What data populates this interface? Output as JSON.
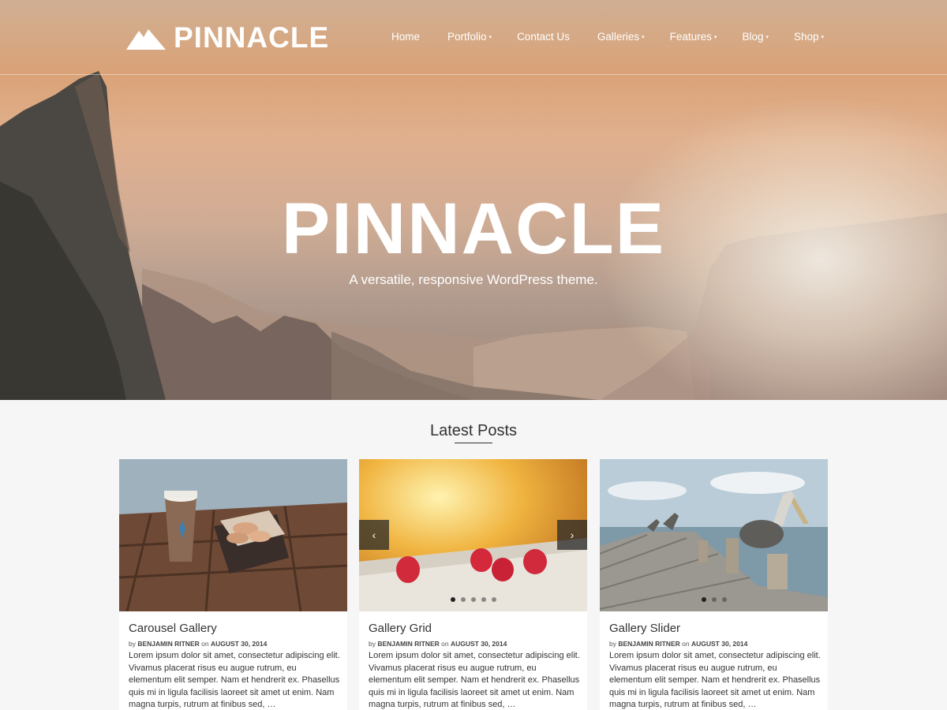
{
  "header": {
    "logo_text": "PINNACLE",
    "nav": [
      {
        "label": "Home",
        "caret": ""
      },
      {
        "label": "Portfolio",
        "caret": "▾"
      },
      {
        "label": "Contact Us",
        "caret": ""
      },
      {
        "label": "Galleries",
        "caret": "▾"
      },
      {
        "label": "Features",
        "caret": "▾"
      },
      {
        "label": "Blog",
        "caret": "▾"
      },
      {
        "label": "Shop",
        "caret": "▾"
      }
    ]
  },
  "hero": {
    "title": "PINNACLE",
    "tagline": "A versatile, responsive WordPress theme."
  },
  "latest": {
    "heading": "Latest Posts",
    "posts": [
      {
        "title": "Carousel Gallery",
        "by": "by",
        "author": "BENJAMIN RITNER",
        "on": "on",
        "date": "AUGUST 30, 2014",
        "excerpt": "Lorem ipsum dolor sit amet, consectetur adipiscing elit. Vivamus placerat risus eu augue rutrum, eu elementum elit semper. Nam et hendrerit ex. Phasellus quis mi in ligula facilisis laoreet sit amet ut enim. Nam magna turpis, rutrum at finibus sed, …"
      },
      {
        "title": "Gallery Grid",
        "by": "by",
        "author": "BENJAMIN RITNER",
        "on": "on",
        "date": "AUGUST 30, 2014",
        "excerpt": "Lorem ipsum dolor sit amet, consectetur adipiscing elit. Vivamus placerat risus eu augue rutrum, eu elementum elit semper. Nam et hendrerit ex. Phasellus quis mi in ligula facilisis laoreet sit amet ut enim. Nam magna turpis, rutrum at finibus sed, …",
        "prev_glyph": "‹",
        "next_glyph": "›"
      },
      {
        "title": "Gallery Slider",
        "by": "by",
        "author": "BENJAMIN RITNER",
        "on": "on",
        "date": "AUGUST 30, 2014",
        "excerpt": "Lorem ipsum dolor sit amet, consectetur adipiscing elit. Vivamus placerat risus eu augue rutrum, eu elementum elit semper. Nam et hendrerit ex. Phasellus quis mi in ligula facilisis laoreet sit amet ut enim. Nam magna turpis, rutrum at finibus sed, …"
      }
    ]
  },
  "colors": {
    "page_bg": "#f6f6f6",
    "card_bg": "#ffffff",
    "hero_sky": "#e3a97d",
    "text": "#333333"
  }
}
